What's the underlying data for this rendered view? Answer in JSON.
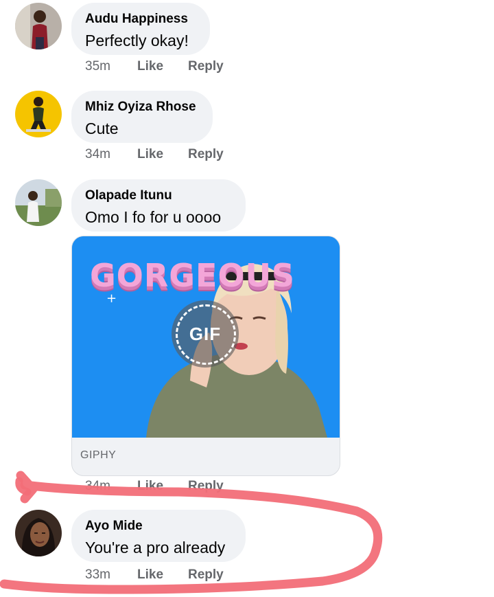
{
  "comments": [
    {
      "author": "Audu Happiness",
      "text": "Perfectly okay!",
      "time": "35m",
      "like": "Like",
      "reply": "Reply"
    },
    {
      "author": "Mhiz Oyiza Rhose",
      "text": "Cute",
      "time": "34m",
      "like": "Like",
      "reply": "Reply"
    },
    {
      "author": "Olapade Itunu",
      "text": "Omo I fo for u oooo",
      "time": "34m",
      "like": "Like",
      "reply": "Reply",
      "gif": {
        "caption": "GORGEOUS",
        "badge": "GIF",
        "source": "GIPHY"
      }
    },
    {
      "author": "Ayo Mide",
      "text": "You're a pro already",
      "time": "33m",
      "like": "Like",
      "reply": "Reply"
    }
  ],
  "colors": {
    "bubble": "#f0f2f5",
    "meta": "#65676b",
    "annotation": "#f26e78",
    "gif_bg": "#1d8ef2"
  }
}
